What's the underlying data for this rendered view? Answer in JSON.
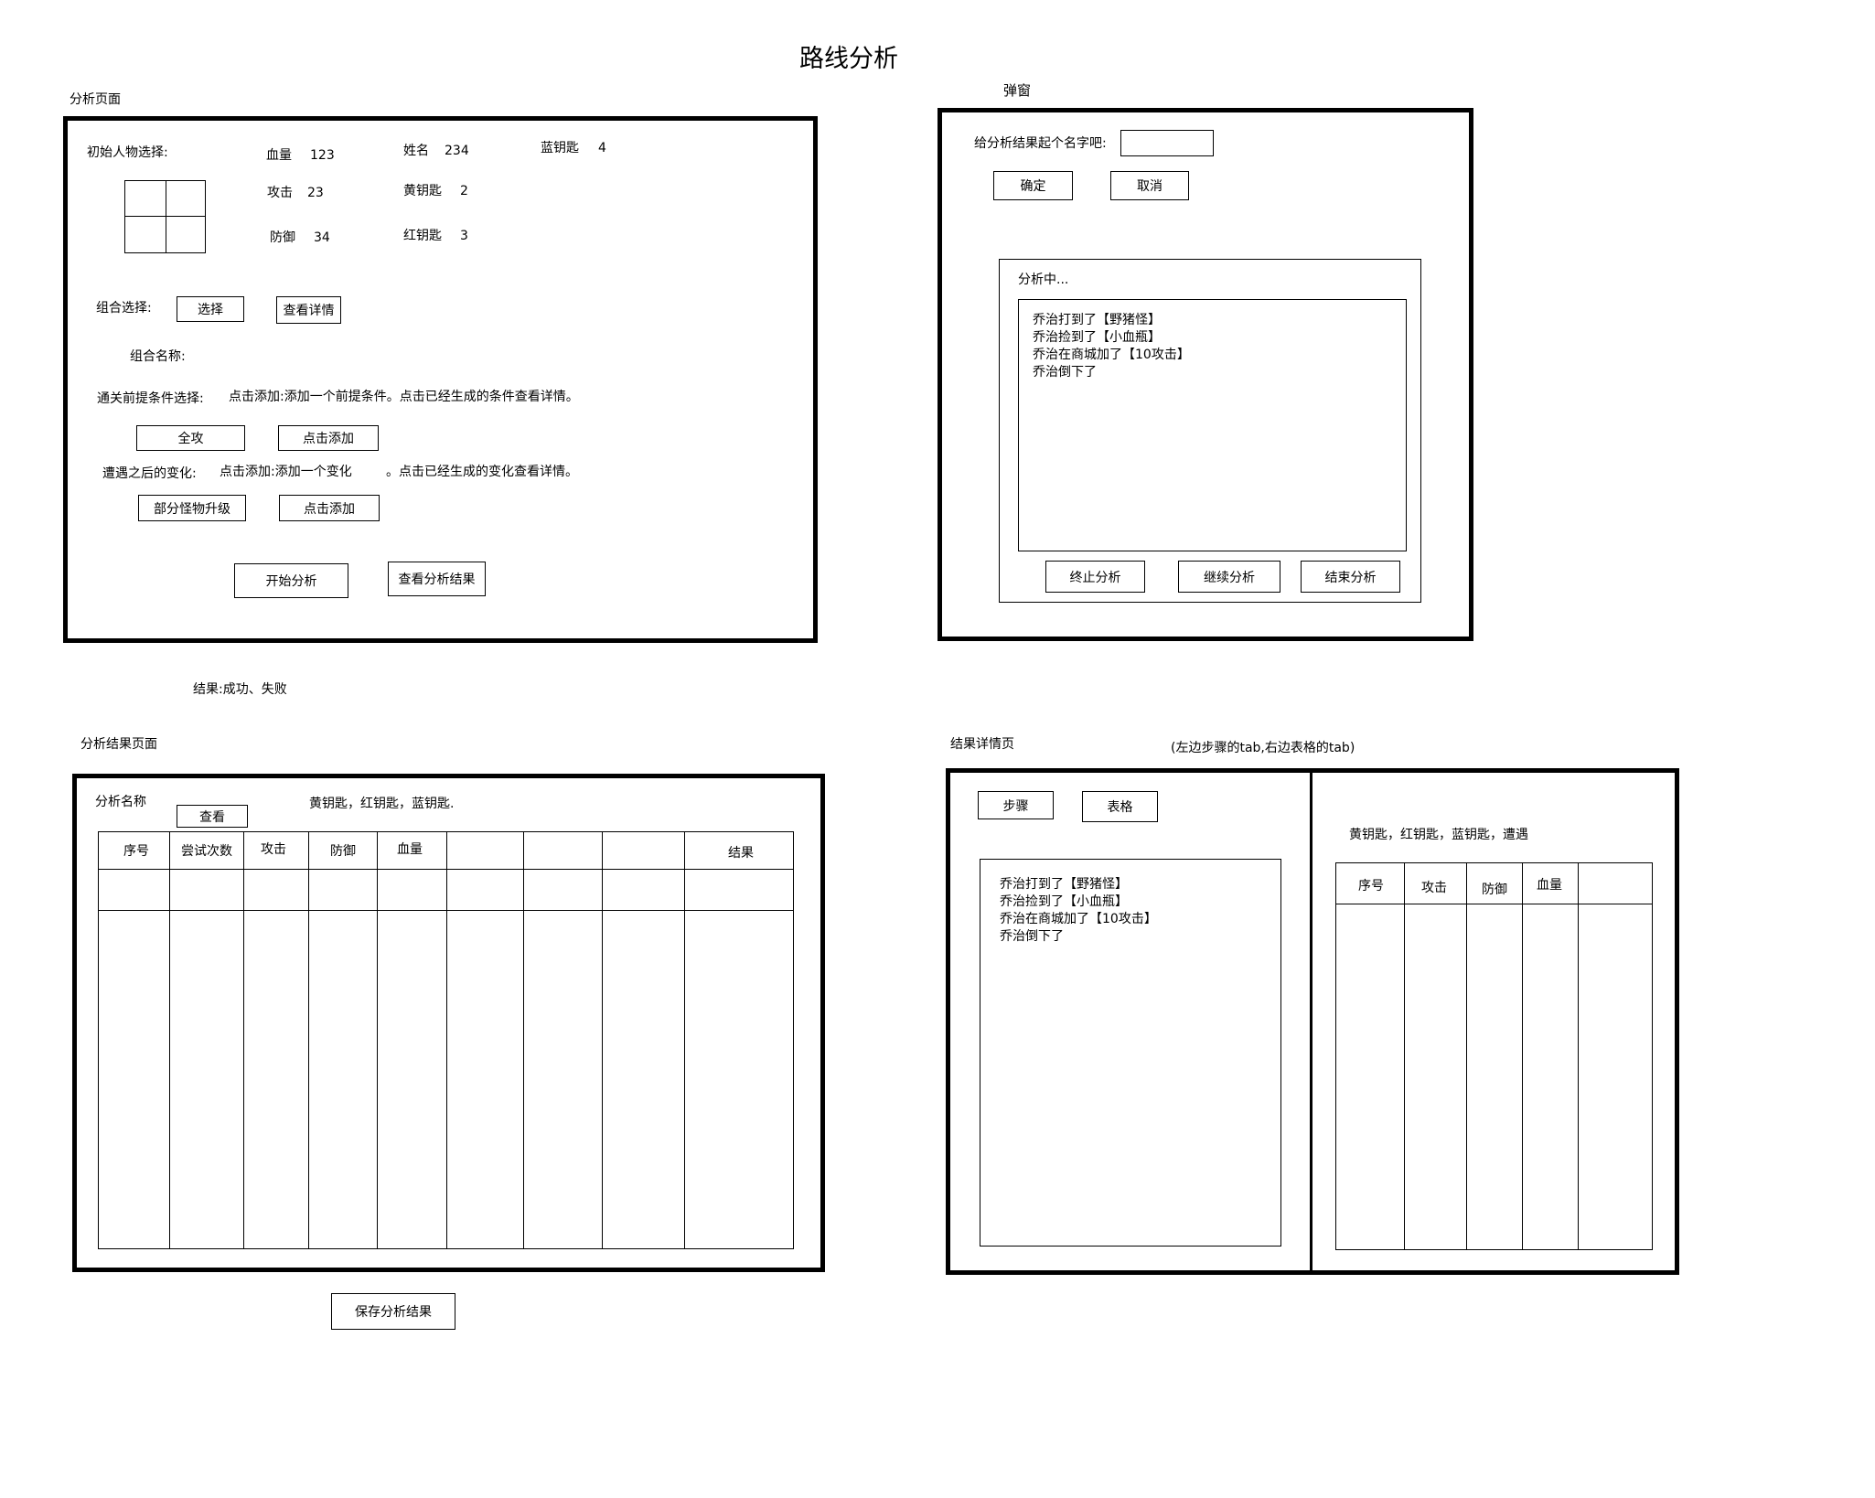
{
  "page_title": "路线分析",
  "analysis_page": {
    "section_label": "分析页面",
    "initial_character_label": "初始人物选择:",
    "stats": [
      {
        "label": "血量",
        "value": "123"
      },
      {
        "label": "攻击",
        "value": "23"
      },
      {
        "label": "防御",
        "value": "34"
      },
      {
        "label": "姓名",
        "value": "234"
      },
      {
        "label": "黄钥匙",
        "value": "2"
      },
      {
        "label": "红钥匙",
        "value": "3"
      },
      {
        "label": "蓝钥匙",
        "value": "4"
      }
    ],
    "combo_label": "组合选择:",
    "select_button": "选择",
    "view_detail_button": "查看详情",
    "combo_name_label": "组合名称:",
    "precondition_label": "通关前提条件选择:",
    "precondition_hint": "点击添加:添加一个前提条件。点击已经生成的条件查看详情。",
    "precondition_tag": "全攻",
    "precondition_add_button": "点击添加",
    "change_label": "遭遇之后的变化:",
    "change_hint_a": "点击添加:添加一个变化",
    "change_hint_b": "。点击已经生成的变化查看详情。",
    "change_tag": "部分怪物升级",
    "change_add_button": "点击添加",
    "start_button": "开始分析",
    "view_results_button": "查看分析结果"
  },
  "result_note": "结果:成功、失败",
  "popup": {
    "section_label": "弹窗",
    "name_prompt": "给分析结果起个名字吧:",
    "name_value": "",
    "confirm_button": "确定",
    "cancel_button": "取消",
    "analyzing_label": "分析中...",
    "log_lines": [
      "乔治打到了【野猪怪】",
      "乔治捡到了【小血瓶】",
      "乔治在商城加了【10攻击】",
      "乔治倒下了"
    ],
    "stop_button": "终止分析",
    "continue_button": "继续分析",
    "end_button": "结束分析"
  },
  "results_page": {
    "section_label": "分析结果页面",
    "name_label": "分析名称",
    "view_button": "查看",
    "keys_note": "黄钥匙，红钥匙，蓝钥匙.",
    "columns": [
      "序号",
      "尝试次数",
      "攻击",
      "防御",
      "血量",
      "",
      "",
      "",
      "结果"
    ],
    "save_button": "保存分析结果"
  },
  "detail_page": {
    "section_label": "结果详情页",
    "note": "(左边步骤的tab,右边表格的tab)",
    "tab_steps": "步骤",
    "tab_table": "表格",
    "log_lines": [
      "乔治打到了【野猪怪】",
      "乔治捡到了【小血瓶】",
      "乔治在商城加了【10攻击】",
      "乔治倒下了"
    ],
    "keys_note": "黄钥匙，红钥匙，蓝钥匙，遭遇",
    "columns": [
      "序号",
      "攻击",
      "防御",
      "血量",
      ""
    ]
  }
}
